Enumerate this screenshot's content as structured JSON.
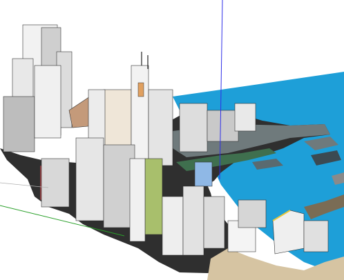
{
  "viewport": {
    "background": "#ffffff",
    "axes": {
      "blue_axis_color": "#2e2ee8",
      "green_axis_color": "#2aa02a"
    }
  },
  "scene": {
    "water_color": "#1e9fd8",
    "ground_color": "#2f2f2f",
    "road_color": "#6f7a7c",
    "park_color": "#3f6f4e",
    "beach_color": "#d6c4a2",
    "building_light": "#f2f2f2",
    "building_shade": "#bcbcbc",
    "building_dark": "#7d7d7d",
    "accent_green": "#a8bf6c",
    "accent_blue": "#8fb8e6",
    "accent_red": "#b0434a",
    "accent_tan": "#d9b480",
    "accent_orange": "#e0a060"
  }
}
